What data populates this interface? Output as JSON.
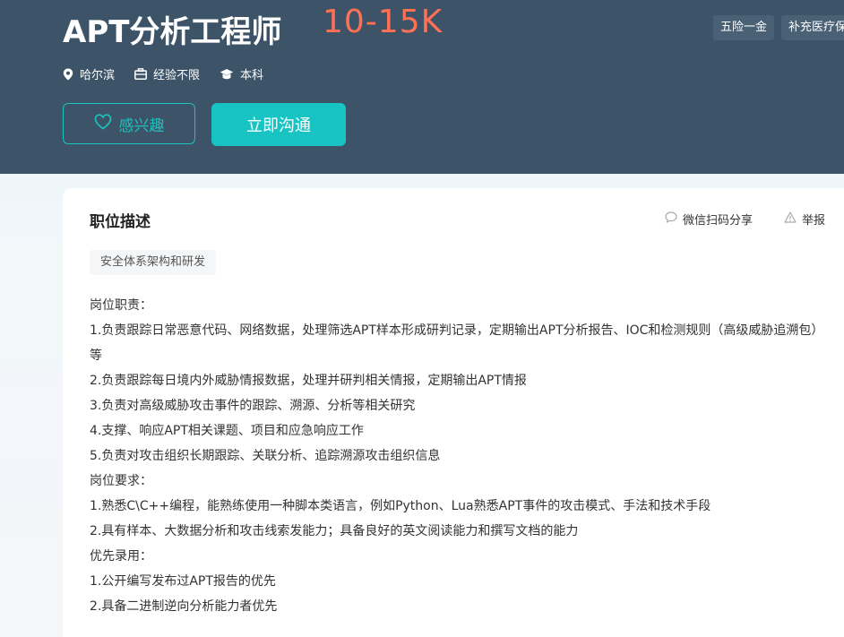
{
  "header": {
    "job_title": "APT分析工程师",
    "salary": "10-15K",
    "welfare": [
      "五险一金",
      "补充医疗保"
    ],
    "meta": {
      "location": "哈尔滨",
      "experience": "经验不限",
      "education": "本科"
    },
    "interest_label": "感兴趣",
    "chat_label": "立即沟通"
  },
  "card": {
    "section_title": "职位描述",
    "share_label": "微信扫码分享",
    "report_label": "举报",
    "keyword_tag": "安全体系架构和研发",
    "description_lines": [
      "岗位职责：",
      "1.负责跟踪日常恶意代码、网络数据，处理筛选APT样本形成研判记录，定期输出APT分析报告、IOC和检测规则（高级威胁追溯包）等",
      "2.负责跟踪每日境内外威胁情报数据，处理并研判相关情报，定期输出APT情报",
      "3.负责对高级威胁攻击事件的跟踪、溯源、分析等相关研究",
      "4.支撑、响应APT相关课题、项目和应急响应工作",
      "5.负责对攻击组织长期跟踪、关联分析、追踪溯源攻击组织信息",
      "岗位要求：",
      "1.熟悉C\\C++编程，能熟练使用一种脚本类语言，例如Python、Lua熟悉APT事件的攻击模式、手法和技术手段",
      "2.具有样本、大数据分析和攻击线索发能力；具备良好的英文阅读能力和撰写文档的能力",
      "优先录用：",
      "1.公开编写发布过APT报告的优先",
      "2.具备二进制逆向分析能力者优先"
    ]
  },
  "colors": {
    "header_bg": "#3d5468",
    "salary": "#ff7055",
    "accent": "#17c3c3"
  },
  "icons": {
    "location": "location-pin-icon",
    "experience": "briefcase-icon",
    "education": "graduation-cap-icon",
    "interest": "heart-icon",
    "share": "chat-bubble-icon",
    "report": "warning-triangle-icon"
  }
}
